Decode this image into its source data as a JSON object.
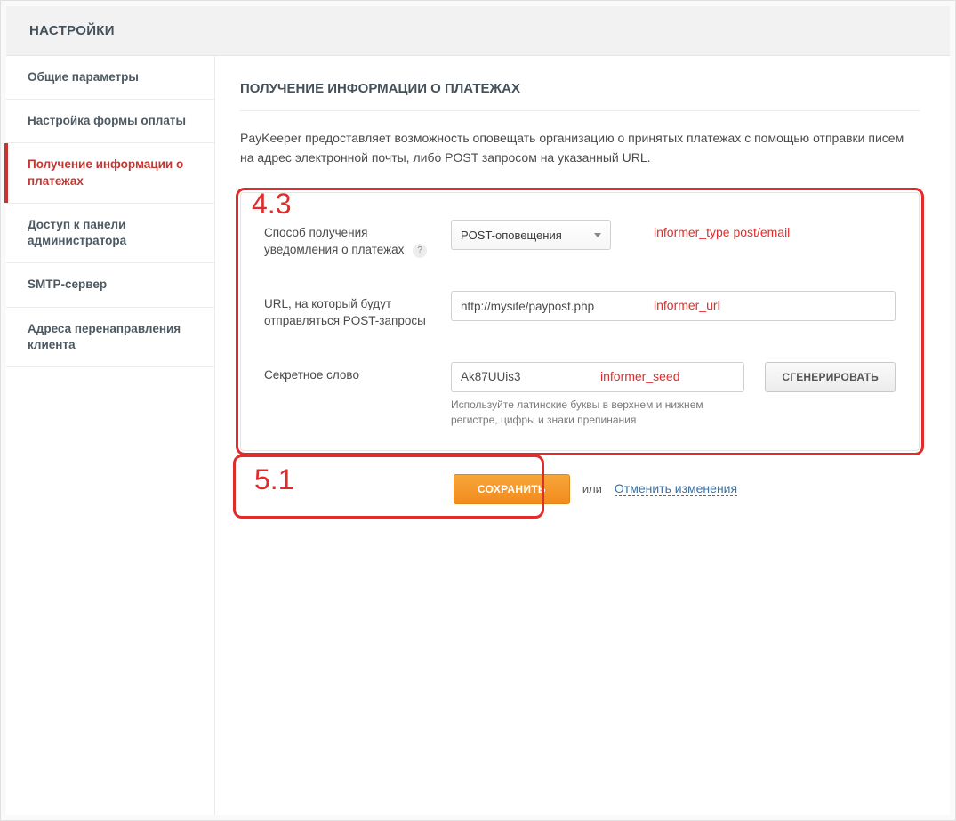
{
  "header": {
    "title": "НАСТРОЙКИ"
  },
  "sidebar": {
    "items": [
      {
        "label": "Общие параметры"
      },
      {
        "label": "Настройка формы оплаты"
      },
      {
        "label": "Получение информации о платежах"
      },
      {
        "label": "Доступ к панели администратора"
      },
      {
        "label": "SMTP-сервер"
      },
      {
        "label": "Адреса перенаправления клиента"
      }
    ],
    "activeIndex": 2
  },
  "main": {
    "title": "ПОЛУЧЕНИЕ ИНФОРМАЦИИ О ПЛАТЕЖАХ",
    "description": "PayKeeper предоставляет возможность оповещать организацию о принятых платежах с помощью отправки писем на адрес электронной почты, либо POST запросом на указанный URL."
  },
  "form": {
    "notificationMethod": {
      "label": "Способ получения уведомления о платежах",
      "help": "?",
      "value": "POST-оповещения"
    },
    "postUrl": {
      "label": "URL, на который будут отправляться  POST-запросы",
      "value": "http://mysite/paypost.php"
    },
    "secret": {
      "label": "Секретное слово",
      "value": "Ak87UUis3",
      "hint": "Используйте латинские буквы в верхнем и нижнем регистре, цифры и знаки препинания",
      "generateBtn": "СГЕНЕРИРОВАТЬ"
    }
  },
  "actions": {
    "save": "СОХРАНИТЬ",
    "or": "или",
    "cancel": "Отменить изменения"
  },
  "annotations": {
    "box1": "4.3",
    "box2": "5.1",
    "tag_type": "informer_type   post/email",
    "tag_url": "informer_url",
    "tag_seed": "informer_seed"
  }
}
